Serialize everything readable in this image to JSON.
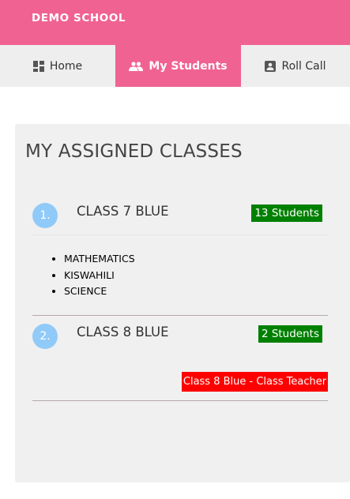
{
  "brand": "DEMO SCHOOL",
  "nav": {
    "tabs": [
      {
        "label": "Home",
        "icon": "dashboard-icon",
        "active": false
      },
      {
        "label": "My Students",
        "icon": "people-icon",
        "active": true
      },
      {
        "label": "Roll Call",
        "icon": "contact-card-icon",
        "active": false
      }
    ]
  },
  "card": {
    "title": "MY ASSIGNED CLASSES",
    "classes": [
      {
        "number": "1.",
        "name": "CLASS 7 BLUE",
        "students_badge": "13 Students",
        "subjects": [
          "MATHEMATICS",
          "KISWAHILI",
          "SCIENCE"
        ]
      },
      {
        "number": "2.",
        "name": "CLASS 8 BLUE",
        "students_badge": "2 Students",
        "role_badge": "Class 8 Blue - Class Teacher"
      }
    ]
  },
  "colors": {
    "primary": "#f06292",
    "nav_bg": "#eeeeee",
    "card_bg": "#f0f0f0",
    "number_circle": "#90caf9",
    "success_badge": "#008000",
    "danger_badge": "#ff0000"
  }
}
